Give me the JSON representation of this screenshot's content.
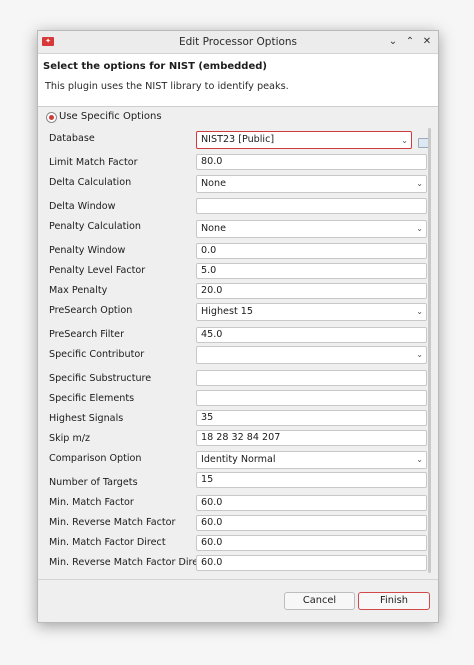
{
  "window": {
    "title": "Edit Processor Options",
    "app_icon": "app-logo-icon",
    "controls": [
      "chevron-down-icon",
      "chevron-up-icon",
      "close-icon"
    ]
  },
  "header": {
    "title": "Select the options for NIST (embedded)",
    "description": "This plugin uses the NIST library to identify peaks."
  },
  "mode": {
    "label": "Use Specific Options",
    "selected": true
  },
  "options": [
    {
      "label": "Database",
      "value": "NIST23 [Public]",
      "type": "select"
    },
    {
      "label": "Limit Match Factor",
      "value": "80.0",
      "type": "text"
    },
    {
      "label": "Delta Calculation",
      "value": "None",
      "type": "select"
    },
    {
      "label": "Delta Window",
      "value": "",
      "type": "text"
    },
    {
      "label": "Penalty Calculation",
      "value": "None",
      "type": "select"
    },
    {
      "label": "Penalty Window",
      "value": "0.0",
      "type": "text"
    },
    {
      "label": "Penalty Level Factor",
      "value": "5.0",
      "type": "text"
    },
    {
      "label": "Max Penalty",
      "value": "20.0",
      "type": "text"
    },
    {
      "label": "PreSearch Option",
      "value": "Highest 15",
      "type": "select"
    },
    {
      "label": "PreSearch Filter",
      "value": "45.0",
      "type": "text"
    },
    {
      "label": "Specific Contributor",
      "value": "",
      "type": "select"
    },
    {
      "label": "Specific Substructure",
      "value": "",
      "type": "text"
    },
    {
      "label": "Specific Elements",
      "value": "",
      "type": "text"
    },
    {
      "label": "Highest Signals",
      "value": "35",
      "type": "text"
    },
    {
      "label": "Skip m/z",
      "value": "18 28 32 84 207",
      "type": "text"
    },
    {
      "label": "Comparison Option",
      "value": "Identity Normal",
      "type": "select"
    },
    {
      "label": "Number of Targets",
      "value": "15",
      "type": "text"
    },
    {
      "label": "Min. Match Factor",
      "value": "60.0",
      "type": "text"
    },
    {
      "label": "Min. Reverse Match Factor",
      "value": "60.0",
      "type": "text"
    },
    {
      "label": "Min. Match Factor Direct",
      "value": "60.0",
      "type": "text"
    },
    {
      "label": "Min. Reverse Match Factor Direct",
      "value": "60.0",
      "type": "text"
    }
  ],
  "buttons": {
    "cancel": "Cancel",
    "finish": "Finish"
  },
  "colors": {
    "accent": "#d23a3a",
    "finish_border": "#d04a4a"
  }
}
